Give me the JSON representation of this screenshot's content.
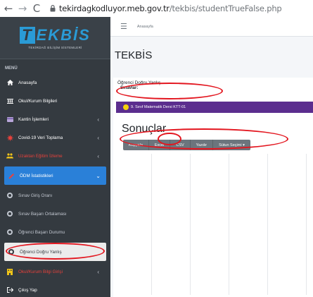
{
  "browser": {
    "url_host": "tekirdagkodluyor.meb.gov.tr",
    "url_path": "/tekbis/studentTrueFalse.php"
  },
  "sidebar": {
    "logo_text": "EKBİS",
    "logo_letter": "T",
    "logo_subtitle": "TEKİRDAĞ BİLİŞİM SİSTEMLERİ",
    "menu_header": "MENÜ",
    "items": [
      {
        "label": "Anasayfa",
        "icon": "home-icon"
      },
      {
        "label": "Okul/Kurum Bilgileri",
        "icon": "building-icon"
      },
      {
        "label": "Kantin İşlemleri",
        "icon": "card-icon"
      },
      {
        "label": "Covid-19 Veri Toplama",
        "icon": "virus-icon"
      },
      {
        "label": "Uzaktan Eğitim İzleme",
        "icon": "people-icon"
      },
      {
        "label": "ÖDM İstatistikleri",
        "icon": "pencil-icon"
      },
      {
        "label": "Sınav Giriş Oranı",
        "icon": "circle-icon"
      },
      {
        "label": "Sınav Başarı Ortalaması",
        "icon": "circle-icon"
      },
      {
        "label": "Öğrenci Başarı Durumu",
        "icon": "circle-icon"
      },
      {
        "label": "Öğrenci Doğru Yanlış",
        "icon": "circle-icon"
      },
      {
        "label": "Okul/Kurum Bilgi Girişi",
        "icon": "building-icon"
      },
      {
        "label": "Çıkış Yap",
        "icon": "logout-icon"
      }
    ]
  },
  "topbar": {
    "breadcrumb": "Anasayfa"
  },
  "main": {
    "title": "TEKBİS",
    "subtitle": "Öğrenci Doğru Yanlış",
    "exam_label": "Sınavlar:",
    "exam_item": "9. Sınıf Matematik Dersi KTT-01",
    "results_title": "Sonuçlar",
    "buttons": [
      "Kopyala",
      "Excel",
      "CSV",
      "Yazdır",
      "Sütun Seçimi ▾"
    ]
  },
  "colors": {
    "sidebar_bg": "#343a40",
    "accent_blue": "#2a80d8",
    "exam_purple": "#5b2d8e",
    "annotation_red": "#e3161f"
  }
}
